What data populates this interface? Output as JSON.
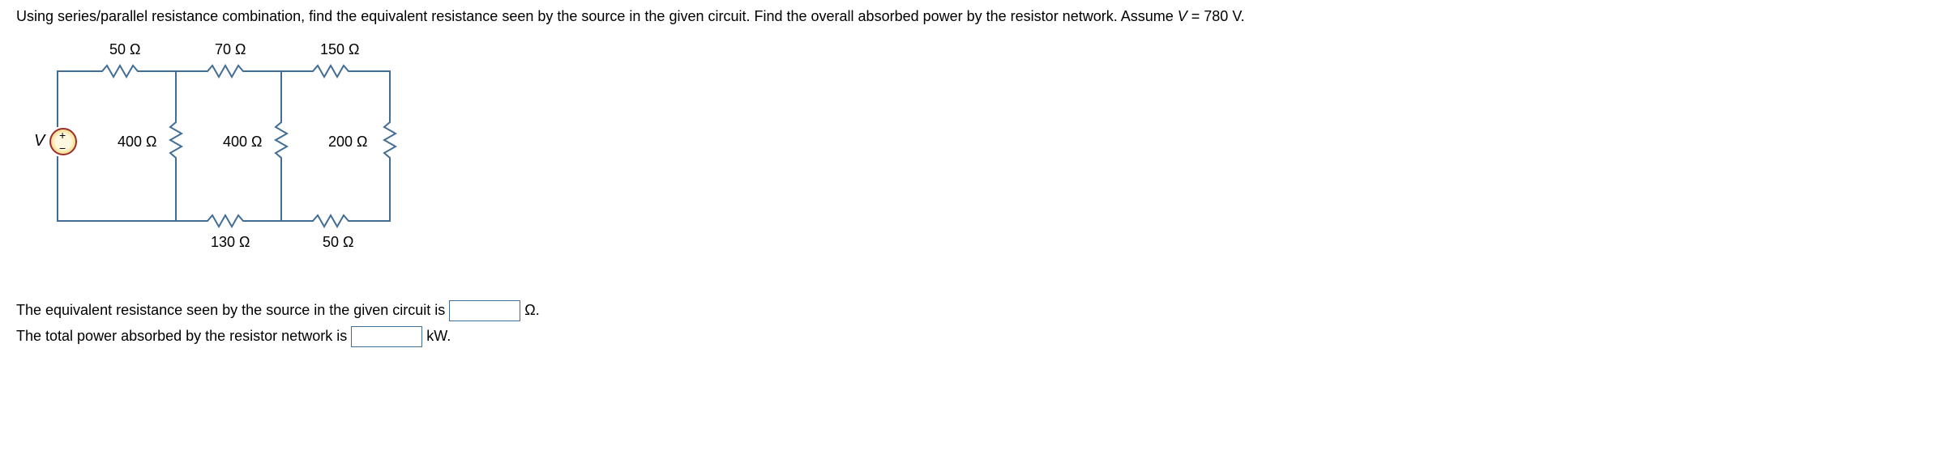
{
  "problem": {
    "text_part1": "Using series/parallel resistance combination, find the equivalent resistance seen by the source in the given circuit. Find the overall absorbed power by the resistor network. Assume ",
    "variable_V": "V",
    "text_part2": " = 780 V."
  },
  "circuit": {
    "source_label": "V",
    "r_top_1": "50 Ω",
    "r_top_2": "70 Ω",
    "r_top_3": "150 Ω",
    "r_vert_1": "400 Ω",
    "r_vert_2": "400 Ω",
    "r_vert_3": "200 Ω",
    "r_bot_1": "130 Ω",
    "r_bot_2": "50 Ω",
    "plus": "+",
    "minus": "−"
  },
  "answers": {
    "line1_before": "The equivalent resistance seen by the source in the given circuit is ",
    "line1_unit": " Ω.",
    "line2_before": "The total power absorbed by the resistor network is ",
    "line2_unit": " kW."
  }
}
